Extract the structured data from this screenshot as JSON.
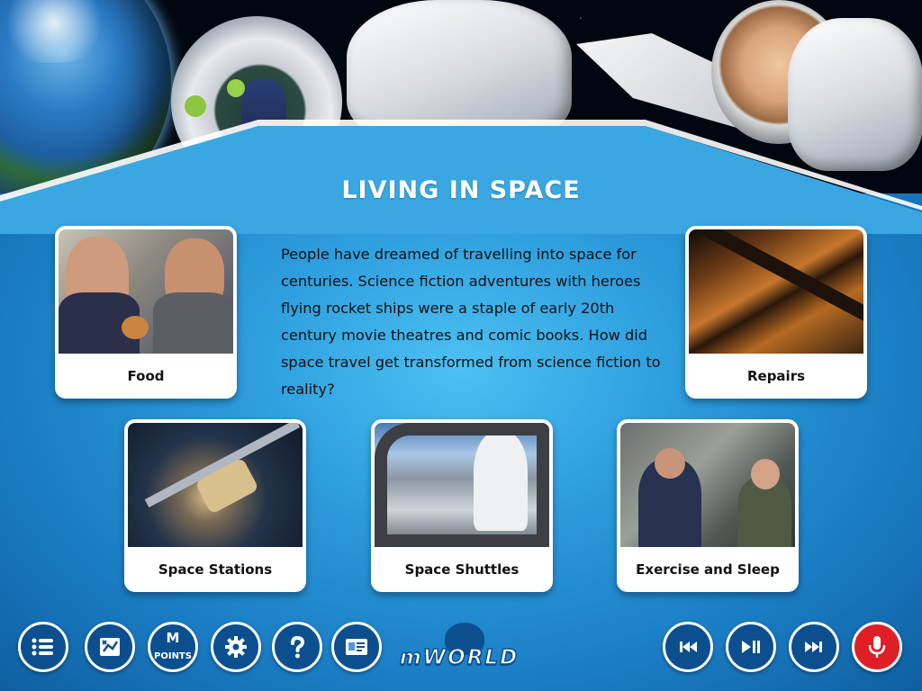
{
  "page": {
    "title": "LIVING IN SPACE",
    "intro": "People have dreamed of travelling into space for centuries. Science fiction adventures with heroes flying rocket ships were a staple of early 20th century movie theatres and comic books. How did space travel get transformed from science fiction to reality?"
  },
  "topics": [
    {
      "label": "Food"
    },
    {
      "label": "Repairs"
    },
    {
      "label": "Space Stations"
    },
    {
      "label": "Space Shuttles"
    },
    {
      "label": "Exercise and Sleep"
    }
  ],
  "toolbar": {
    "points_label": "POINTS",
    "points_letter": "M",
    "logo_text": "mWORLD"
  },
  "icons": {
    "menu": "menu-list-icon",
    "puzzle": "puzzle-icon",
    "points": "m-points-icon",
    "settings": "gear-icon",
    "help": "question-icon",
    "profile": "id-card-icon",
    "rewind": "skip-back-icon",
    "playpause": "play-pause-icon",
    "forward": "skip-forward-icon",
    "record": "microphone-icon"
  },
  "colors": {
    "accent_dark": "#0b4f8f",
    "record_red": "#e01e26",
    "panel_blue": "#2b9bdc"
  }
}
